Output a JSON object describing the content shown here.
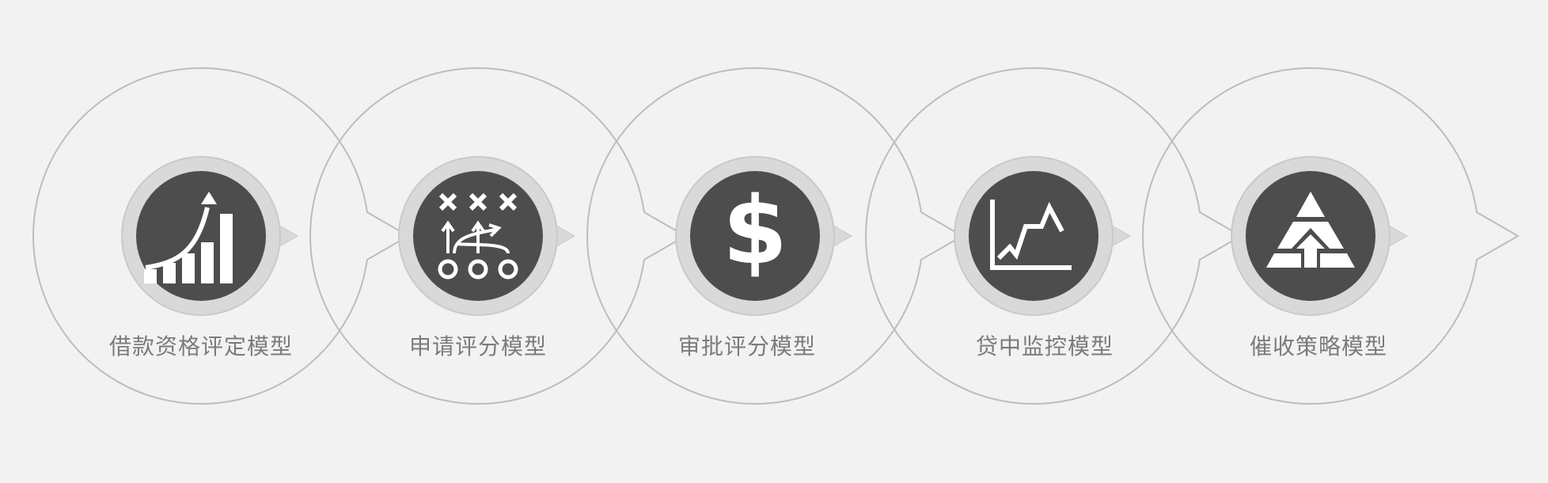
{
  "steps": [
    {
      "label": "借款资格评定模型",
      "icon": "growth-chart-icon"
    },
    {
      "label": "申请评分模型",
      "icon": "strategy-play-icon"
    },
    {
      "label": "审批评分模型",
      "icon": "dollar-icon"
    },
    {
      "label": "贷中监控模型",
      "icon": "line-chart-icon"
    },
    {
      "label": "催收策略模型",
      "icon": "pyramid-icon"
    }
  ],
  "colors": {
    "background": "#f2f2f2",
    "outline": "#bdbdbd",
    "badge_ring": "#d9d9d9",
    "badge_fill": "#4d4d4d",
    "icon": "#ffffff",
    "label": "#7b7b7b"
  }
}
